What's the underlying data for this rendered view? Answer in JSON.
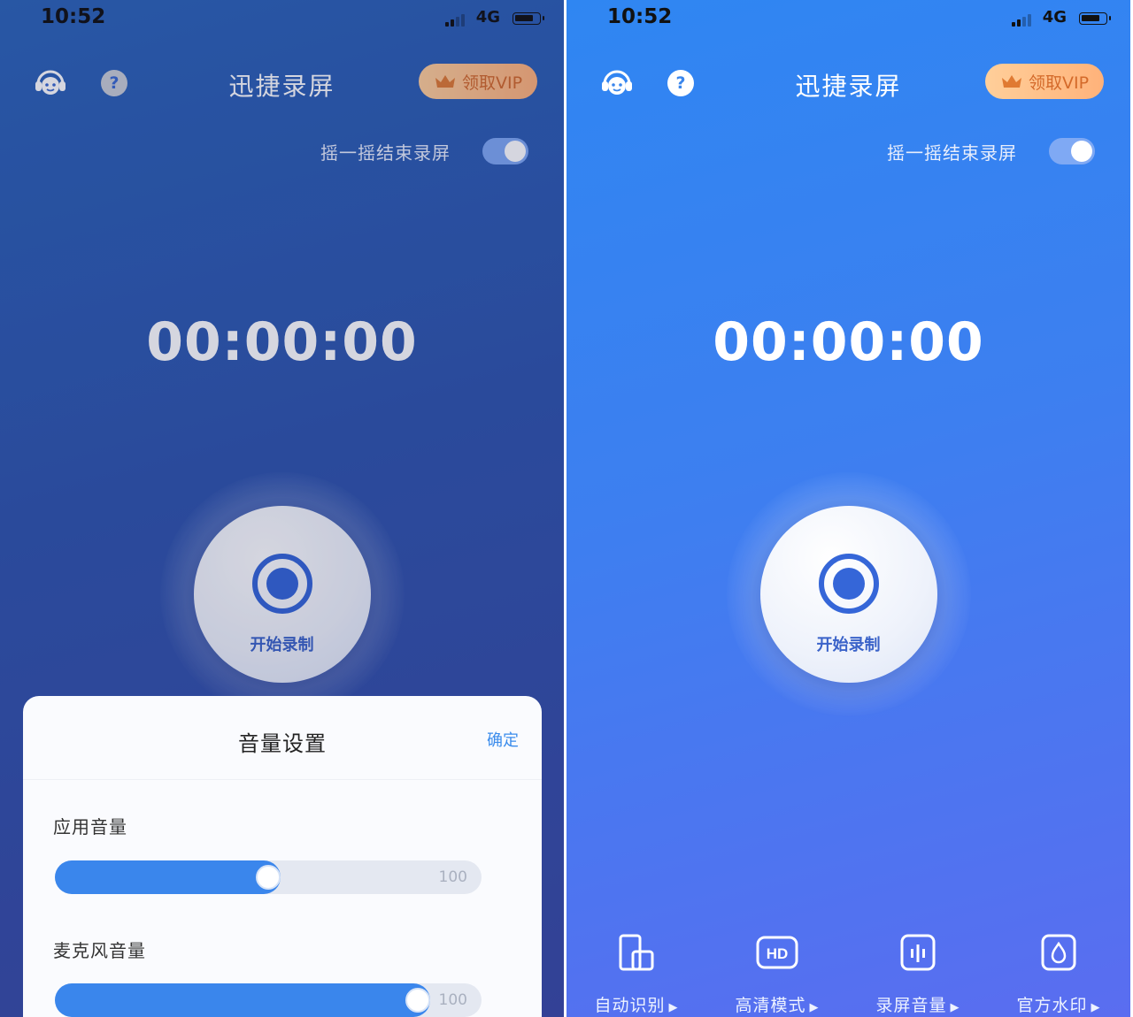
{
  "status_bar": {
    "time": "10:52",
    "network": "4G"
  },
  "header": {
    "title": "迅捷录屏",
    "vip_button_label": "领取VIP"
  },
  "shake_setting": {
    "label": "摇一摇结束录屏",
    "enabled": true
  },
  "timer": "00:00:00",
  "record_button_label": "开始录制",
  "volume_sheet": {
    "title": "音量设置",
    "confirm_label": "确定",
    "app_volume": {
      "label": "应用音量",
      "max": "100",
      "level": 0.5
    },
    "mic_volume": {
      "label": "麦克风音量",
      "max": "100",
      "level": 0.85
    }
  },
  "features": [
    {
      "label": "自动识别",
      "icon": "phone-rotate-icon"
    },
    {
      "label": "高清模式",
      "icon": "hd-icon"
    },
    {
      "label": "录屏音量",
      "icon": "volume-bars-icon"
    },
    {
      "label": "官方水印",
      "icon": "water-drop-icon"
    }
  ],
  "colors": {
    "accent_blue": "#3a86ec",
    "vip_orange": "#ffb27a",
    "record_blue": "#3566d8"
  }
}
